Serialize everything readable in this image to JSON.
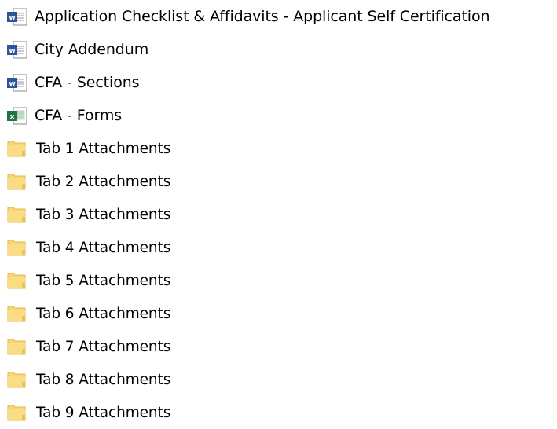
{
  "explorer": {
    "items": [
      {
        "label": "Application Checklist & Affidavits - Applicant Self Certification",
        "type": "word-document",
        "icon": "word-document-icon"
      },
      {
        "label": "City Addendum",
        "type": "word-document",
        "icon": "word-document-icon"
      },
      {
        "label": "CFA - Sections",
        "type": "word-document",
        "icon": "word-document-icon"
      },
      {
        "label": "CFA - Forms",
        "type": "excel-workbook",
        "icon": "excel-workbook-icon"
      },
      {
        "label": "Tab 1 Attachments",
        "type": "folder",
        "icon": "folder-icon"
      },
      {
        "label": "Tab 2 Attachments",
        "type": "folder",
        "icon": "folder-icon"
      },
      {
        "label": "Tab 3 Attachments",
        "type": "folder",
        "icon": "folder-icon"
      },
      {
        "label": "Tab 4 Attachments",
        "type": "folder",
        "icon": "folder-icon"
      },
      {
        "label": "Tab 5 Attachments",
        "type": "folder",
        "icon": "folder-icon"
      },
      {
        "label": "Tab 6 Attachments",
        "type": "folder",
        "icon": "folder-icon"
      },
      {
        "label": "Tab 7 Attachments",
        "type": "folder",
        "icon": "folder-icon"
      },
      {
        "label": "Tab 8 Attachments",
        "type": "folder",
        "icon": "folder-icon"
      },
      {
        "label": "Tab 9 Attachments",
        "type": "folder",
        "icon": "folder-icon"
      }
    ]
  },
  "colors": {
    "word_blue": "#2b579a",
    "excel_green": "#217346",
    "folder_yellow": "#f8d775",
    "folder_edge": "#e0b84a",
    "text": "#000000"
  }
}
